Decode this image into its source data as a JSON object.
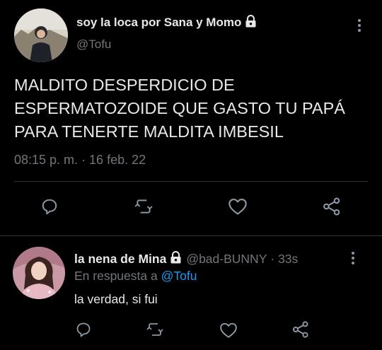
{
  "main_tweet": {
    "display_name": "soy la loca por Sana y Momo",
    "handle": "@Tofu",
    "text_lines": [
      "MALDITO DESPERDICIO DE",
      "ESPERMATOZOIDE QUE GASTO TU PAPÁ",
      "PARA TENERTE MALDITA IMBESIL"
    ],
    "timestamp": "08:15 p. m. · 16 feb. 22"
  },
  "reply": {
    "display_name": "la nena de Mina",
    "handle": "@bad-BUNNY",
    "time": "· 33s",
    "replying_prefix": "En respuesta a",
    "replying_to": "@Tofu",
    "text": "la verdad, si fui"
  },
  "icons": {
    "actions": [
      "reply-icon",
      "retweet-icon",
      "like-icon",
      "share-icon"
    ],
    "lock": "lock-icon",
    "more": "more-options-icon"
  },
  "colors": {
    "background": "#000000",
    "text": "#e7e9ea",
    "muted": "#71767b",
    "link": "#1d9bf0",
    "divider": "#2f3336",
    "icon": "#8b98a5"
  }
}
